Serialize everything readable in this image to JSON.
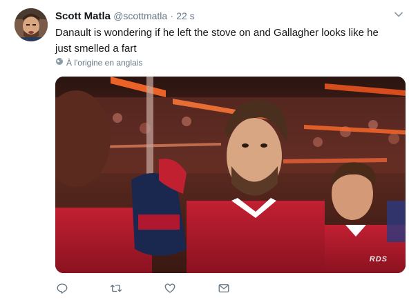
{
  "tweet": {
    "display_name": "Scott Matla",
    "handle": "@scottmatla",
    "separator": "·",
    "time": "22 s",
    "text": "Danault is wondering if he left the stove on and Gallagher looks like he just smelled a fart",
    "translate_label": "À l'origine en anglais",
    "media_logo": "RDS"
  },
  "icons": {
    "caret": "chevron-down-icon",
    "globe": "globe-icon",
    "reply": "reply-icon",
    "retweet": "retweet-icon",
    "like": "heart-icon",
    "dm": "envelope-icon"
  },
  "colors": {
    "text": "#14171a",
    "secondary": "#657786",
    "jersey": "#b0182a"
  }
}
